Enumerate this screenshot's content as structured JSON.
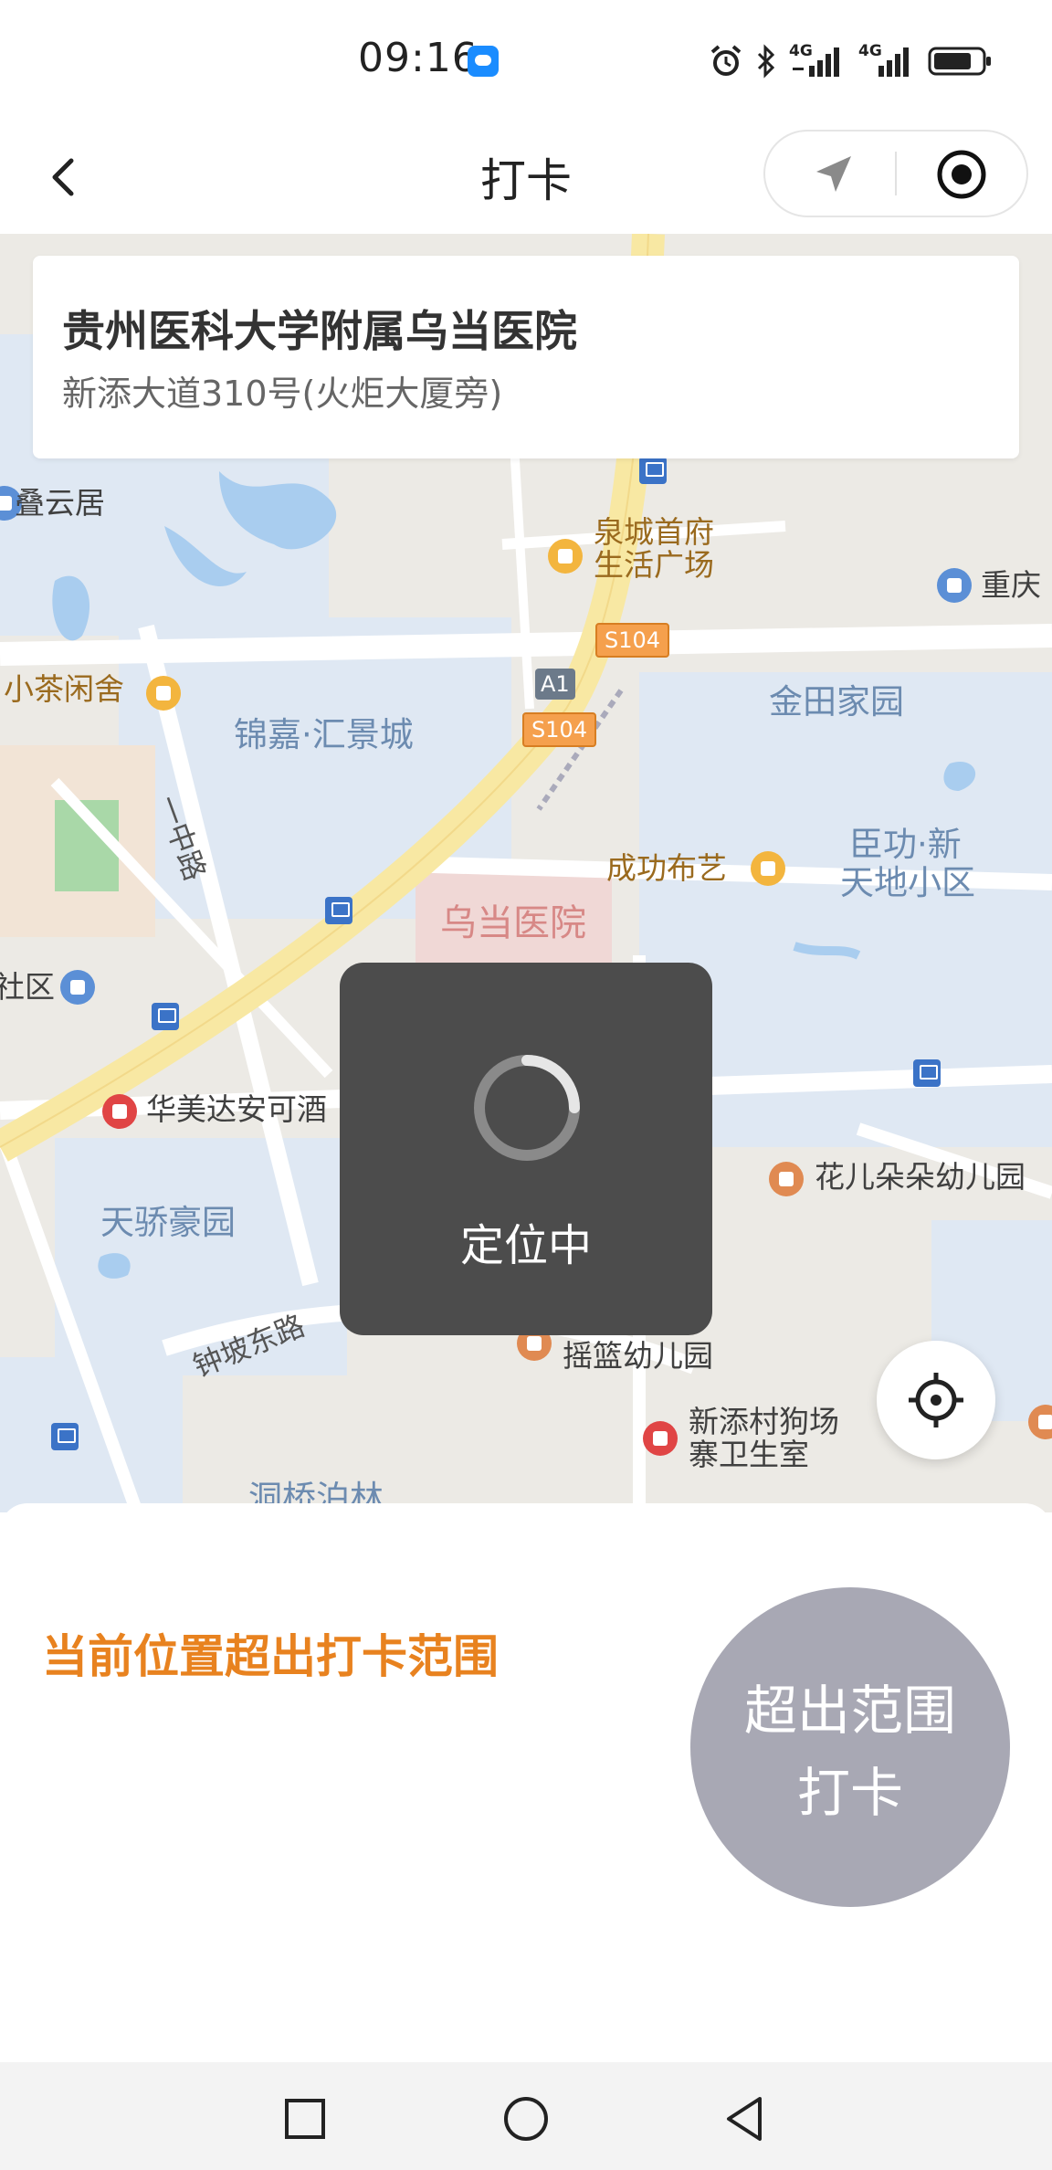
{
  "status_bar": {
    "time": "09:16",
    "network_1": "4G",
    "network_2": "4G",
    "icons": [
      "message-icon",
      "alarm-icon",
      "bluetooth-icon",
      "signal-icon",
      "signal-icon",
      "battery-icon"
    ]
  },
  "nav": {
    "title": "打卡",
    "back_icon": "chevron-left-icon",
    "capsule_icons": [
      "navigation-arrow-icon",
      "target-icon"
    ]
  },
  "location_card": {
    "name": "贵州医科大学附属乌当医院",
    "address": "新添大道310号(火炬大厦旁)"
  },
  "map": {
    "labels": {
      "dieyunju": "叠云居",
      "quancheng_1": "泉城首府",
      "quancheng_2": "生活广场",
      "chongqing": "重庆",
      "xiaocha": "小茶闲舍",
      "jinjia": "锦嘉·汇景城",
      "jintian": "金田家园",
      "s104_a": "S104",
      "s104_b": "S104",
      "a1": "A1",
      "yizhong": "一中路",
      "chenggong": "成功布艺",
      "chengong_1": "臣功·新",
      "chengong_2": "天地小区",
      "wudang": "乌当医院",
      "shequ": "社区",
      "huamei": "华美达安可酒",
      "huaer": "花儿朵朵幼儿园",
      "tianjiao": "天骄豪园",
      "zhongpo": "钟坡东路",
      "yaolan": "摇篮幼儿园",
      "gouchang_1": "新添村狗场",
      "gouchang_2": "寨卫生室",
      "dongqiao": "洞桥泊林"
    },
    "colors": {
      "land": "#eceae5",
      "water": "#a9cdef",
      "residential": "#dfe8f3",
      "road": "#ffffff",
      "main_road": "#f8e8a3",
      "hospital": "#f0d8d6"
    }
  },
  "locate_button_icon": "crosshair-icon",
  "toast": {
    "text": "定位中",
    "icon": "spinner-icon"
  },
  "bottom": {
    "warning": "当前位置超出打卡范围",
    "button_line1": "超出范围",
    "button_line2": "打卡"
  },
  "system_nav": {
    "icons": [
      "recent-apps-icon",
      "home-icon",
      "back-icon"
    ]
  }
}
